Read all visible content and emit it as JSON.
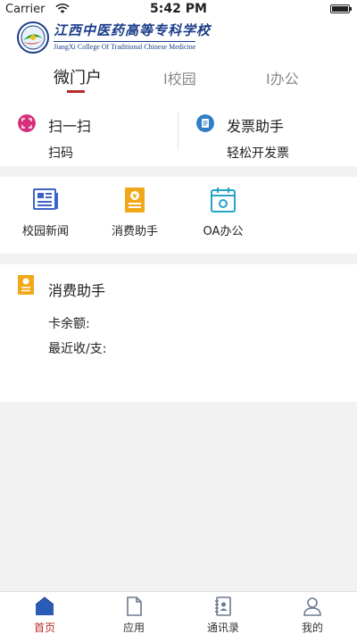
{
  "status": {
    "carrier": "Carrier",
    "time": "5:42 PM"
  },
  "header": {
    "logo_cn": "江西中医药高等专科学校",
    "logo_en": "JiangXi College Of Traditional Chinese Medicine"
  },
  "tabs": [
    {
      "label": "微门户",
      "active": true
    },
    {
      "label": "I校园",
      "active": false
    },
    {
      "label": "I办公",
      "active": false
    }
  ],
  "quick_actions": [
    {
      "title": "扫一扫",
      "subtitle": "扫码",
      "icon": "scan-icon",
      "color": "#d62f7c"
    },
    {
      "title": "发票助手",
      "subtitle": "轻松开发票",
      "icon": "invoice-icon",
      "color": "#2e7fc6"
    }
  ],
  "apps": [
    {
      "label": "校园新闻",
      "icon": "news-icon",
      "color": "#3d63c8"
    },
    {
      "label": "消费助手",
      "icon": "consume-icon",
      "color": "#f0a818"
    },
    {
      "label": "OA办公",
      "icon": "calendar-icon",
      "color": "#27a4c7"
    }
  ],
  "consume_card": {
    "title": "消费助手",
    "balance_label": "卡余额:",
    "recent_label": "最近收/支:"
  },
  "tabbar": [
    {
      "label": "首页",
      "icon": "home-icon",
      "active": true
    },
    {
      "label": "应用",
      "icon": "document-icon",
      "active": false
    },
    {
      "label": "通讯录",
      "icon": "contacts-icon",
      "active": false
    },
    {
      "label": "我的",
      "icon": "profile-icon",
      "active": false
    }
  ],
  "colors": {
    "accent": "#b52a2a",
    "brand": "#1b3d8a"
  }
}
